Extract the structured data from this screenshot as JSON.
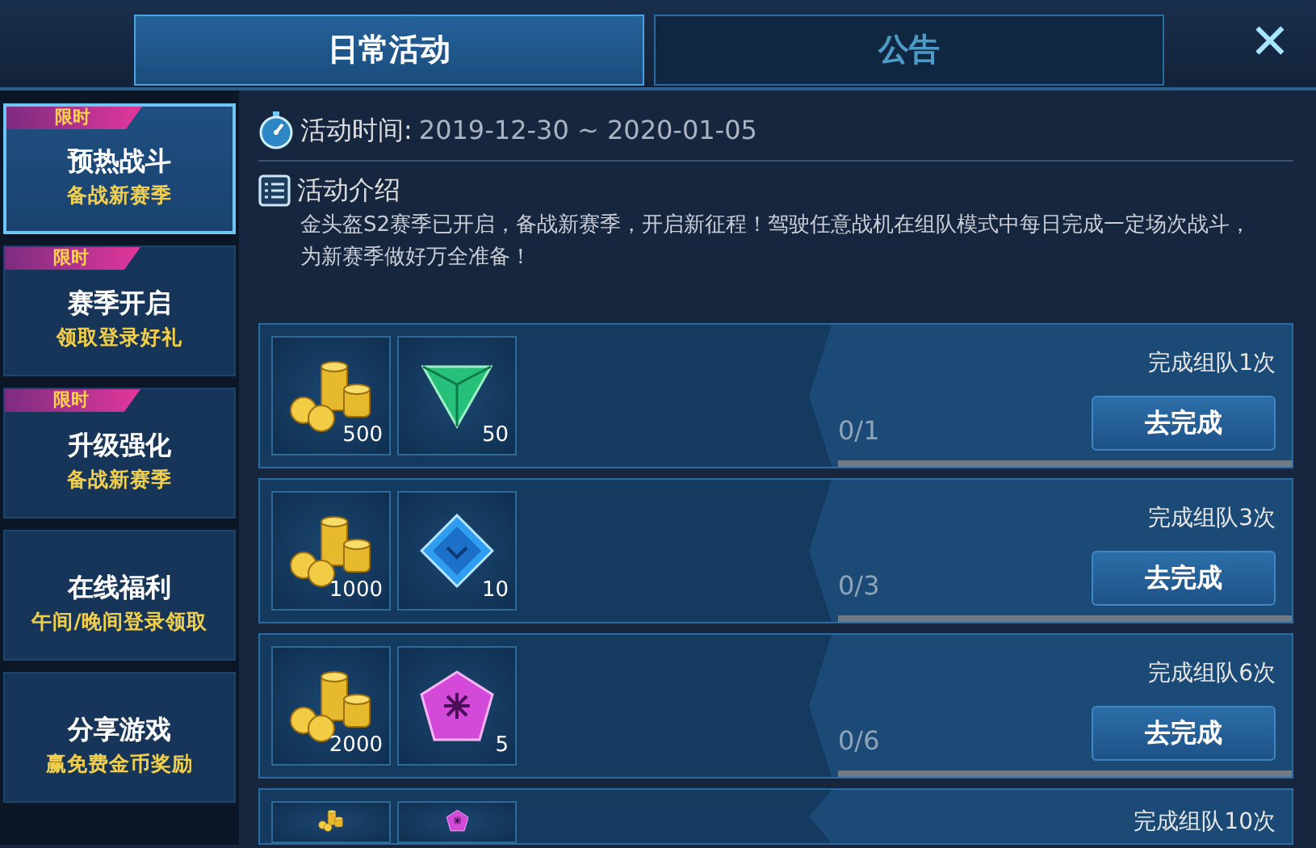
{
  "tabs": [
    {
      "label": "日常活动",
      "selected": true
    },
    {
      "label": "公告",
      "selected": false
    }
  ],
  "close": "✕",
  "sidebar": {
    "items": [
      {
        "tag": "限时",
        "title": "预热战斗",
        "subtitle": "备战新赛季",
        "selected": true
      },
      {
        "tag": "限时",
        "title": "赛季开启",
        "subtitle": "领取登录好礼",
        "selected": false
      },
      {
        "tag": "限时",
        "title": "升级强化",
        "subtitle": "备战新赛季",
        "selected": false
      },
      {
        "title": "在线福利",
        "subtitle": "午间/晚间登录领取",
        "selected": false
      },
      {
        "title": "分享游戏",
        "subtitle": "赢免费金币奖励",
        "selected": false
      }
    ]
  },
  "event": {
    "time_label": "活动时间:",
    "time_value": "2019-12-30 ~ 2020-01-05",
    "intro_title": "活动介绍",
    "intro_text": "金头盔S2赛季已开启，备战新赛季，开启新征程！驾驶任意战机在组队模式中每日完成一定场次战斗，为新赛季做好万全准备！"
  },
  "tasks": [
    {
      "rewards": [
        {
          "kind": "coins",
          "count": "500"
        },
        {
          "kind": "triangle-gem",
          "count": "50"
        }
      ],
      "goal": "完成组队1次",
      "progress": "0/1",
      "level": 0,
      "button": "去完成"
    },
    {
      "rewards": [
        {
          "kind": "coins",
          "count": "1000"
        },
        {
          "kind": "diamond-gem",
          "count": "10"
        }
      ],
      "goal": "完成组队3次",
      "progress": "0/3",
      "level": 0,
      "button": "去完成"
    },
    {
      "rewards": [
        {
          "kind": "coins",
          "count": "2000"
        },
        {
          "kind": "pentagon-gem",
          "count": "5"
        }
      ],
      "goal": "完成组队6次",
      "progress": "0/6",
      "level": 0,
      "button": "去完成"
    },
    {
      "rewards": [
        {
          "kind": "coins"
        },
        {
          "kind": "pentagon-gem"
        }
      ],
      "goal": "完成组队10次"
    }
  ]
}
